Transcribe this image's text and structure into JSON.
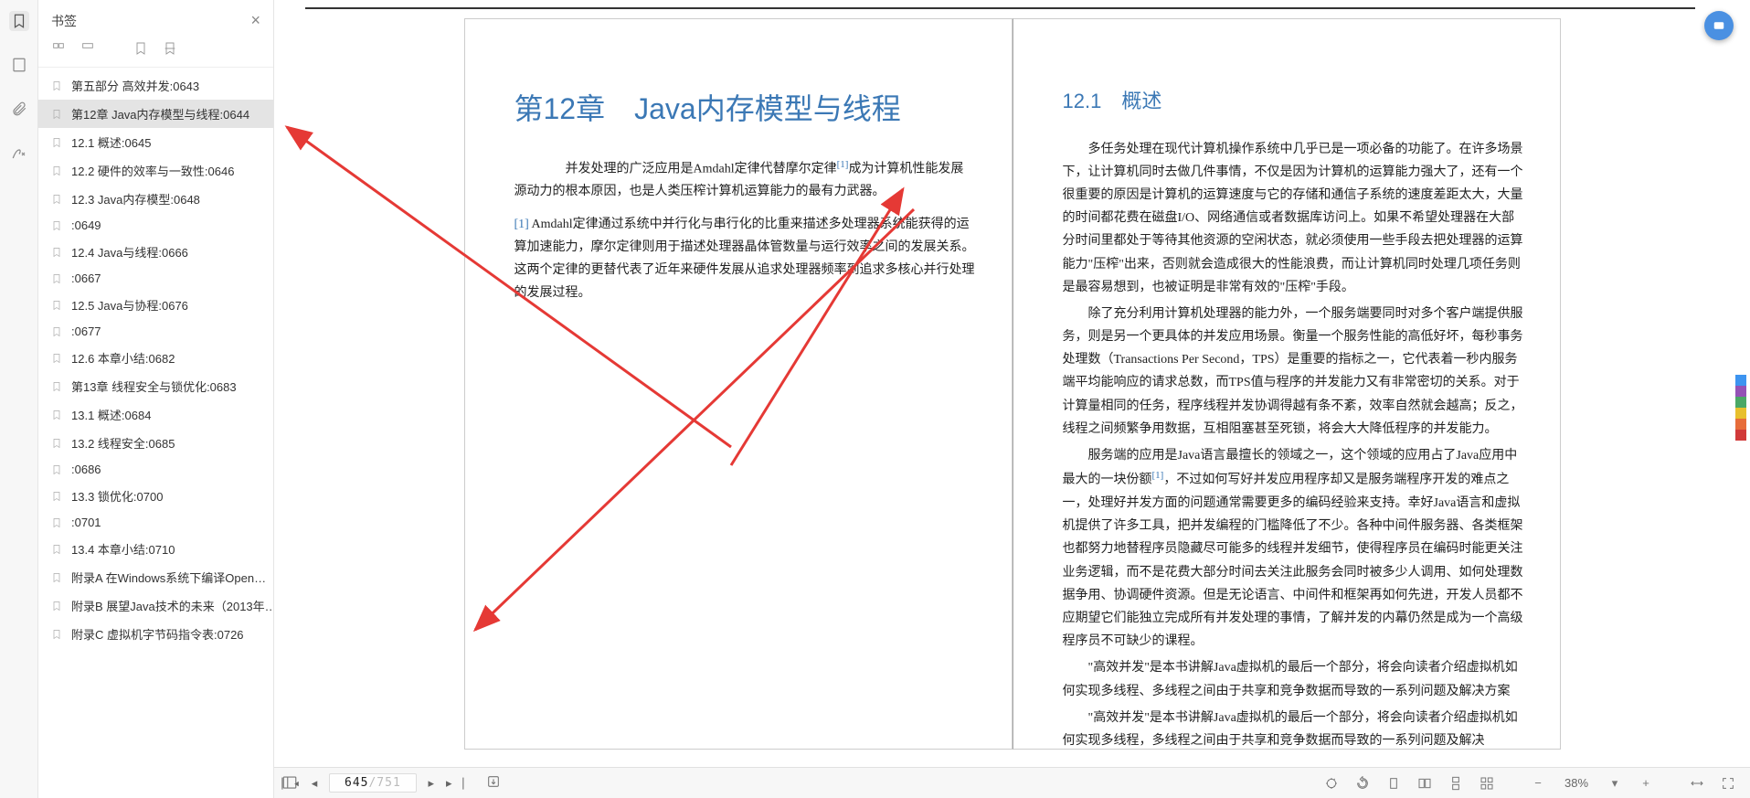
{
  "sidebar": {
    "title": "书签",
    "items": [
      {
        "label": "第五部分 高效并发:0643",
        "selected": false
      },
      {
        "label": "第12章 Java内存模型与线程:0644",
        "selected": true
      },
      {
        "label": "12.1 概述:0645",
        "selected": false
      },
      {
        "label": "12.2 硬件的效率与一致性:0646",
        "selected": false
      },
      {
        "label": "12.3 Java内存模型:0648",
        "selected": false
      },
      {
        "label": ":0649",
        "selected": false
      },
      {
        "label": "12.4 Java与线程:0666",
        "selected": false
      },
      {
        "label": ":0667",
        "selected": false
      },
      {
        "label": "12.5 Java与协程:0676",
        "selected": false
      },
      {
        "label": ":0677",
        "selected": false
      },
      {
        "label": "12.6 本章小结:0682",
        "selected": false
      },
      {
        "label": "第13章 线程安全与锁优化:0683",
        "selected": false
      },
      {
        "label": "13.1 概述:0684",
        "selected": false
      },
      {
        "label": "13.2 线程安全:0685",
        "selected": false
      },
      {
        "label": ":0686",
        "selected": false
      },
      {
        "label": "13.3 锁优化:0700",
        "selected": false
      },
      {
        "label": ":0701",
        "selected": false
      },
      {
        "label": "13.4 本章小结:0710",
        "selected": false
      },
      {
        "label": "附录A 在Windows系统下编译Open…",
        "selected": false
      },
      {
        "label": "附录B 展望Java技术的未来（2013年…",
        "selected": false
      },
      {
        "label": "附录C 虚拟机字节码指令表:0726",
        "selected": false
      }
    ]
  },
  "pages": {
    "left": {
      "heading": "第12章　Java内存模型与线程",
      "p1_a": "　　并发处理的广泛应用是Amdahl定律代替摩尔定律",
      "p1_sup": "[1]",
      "p1_b": "成为计算机性能发展源动力的根本原因，也是人类压榨计算机运算能力的最有力武器。",
      "fn_ref": "[1]",
      "fn_text": " Amdahl定律通过系统中并行化与串行化的比重来描述多处理器系统能获得的运算加速能力，摩尔定律则用于描述处理器晶体管数量与运行效率之间的发展关系。这两个定律的更替代表了近年来硬件发展从追求处理器频率到追求多核心并行处理的发展过程。"
    },
    "right": {
      "heading": "12.1　概述",
      "p1": "多任务处理在现代计算机操作系统中几乎已是一项必备的功能了。在许多场景下，让计算机同时去做几件事情，不仅是因为计算机的运算能力强大了，还有一个很重要的原因是计算机的运算速度与它的存储和通信子系统的速度差距太大，大量的时间都花费在磁盘I/O、网络通信或者数据库访问上。如果不希望处理器在大部分时间里都处于等待其他资源的空闲状态，就必须使用一些手段去把处理器的运算能力\"压榨\"出来，否则就会造成很大的性能浪费，而让计算机同时处理几项任务则是最容易想到，也被证明是非常有效的\"压榨\"手段。",
      "p2": "除了充分利用计算机处理器的能力外，一个服务端要同时对多个客户端提供服务，则是另一个更具体的并发应用场景。衡量一个服务性能的高低好坏，每秒事务处理数（Transactions Per Second，TPS）是重要的指标之一，它代表着一秒内服务端平均能响应的请求总数，而TPS值与程序的并发能力又有非常密切的关系。对于计算量相同的任务，程序线程并发协调得越有条不紊，效率自然就会越高；反之，线程之间频繁争用数据，互相阻塞甚至死锁，将会大大降低程序的并发能力。",
      "p3_a": "服务端的应用是Java语言最擅长的领域之一，这个领域的应用占了Java应用中最大的一块份额",
      "p3_sup": "[1]",
      "p3_b": "，不过如何写好并发应用程序却又是服务端程序开发的难点之一，处理好并发方面的问题通常需要更多的编码经验来支持。幸好Java语言和虚拟机提供了许多工具，把并发编程的门槛降低了不少。各种中间件服务器、各类框架也都努力地替程序员隐藏尽可能多的线程并发细节，使得程序员在编码时能更关注业务逻辑，而不是花费大部分时间去关注此服务会同时被多少人调用、如何处理数据争用、协调硬件资源。但是无论语言、中间件和框架再如何先进，开发人员都不应期望它们能独立完成所有并发处理的事情，了解并发的内幕仍然是成为一个高级程序员不可缺少的课程。",
      "p4": "\"高效并发\"是本书讲解Java虚拟机的最后一个部分，将会向读者介绍虚拟机如何实现多线程、多线程之间由于共享和竞争数据而导致的一系列问题及解决方案",
      "p5": "\"高效并发\"是本书讲解Java虚拟机的最后一个部分，将会向读者介绍虚拟机如何实现多线程，多线程之间由于共享和竞争数据而导致的一系列问题及解决"
    }
  },
  "nav": {
    "current": "645",
    "total": "/751"
  },
  "zoom": {
    "level": "38%"
  },
  "swatches": [
    "#3d94f0",
    "#9452b6",
    "#4aa866",
    "#e8c02d",
    "#e76d3a",
    "#d13a3a"
  ]
}
